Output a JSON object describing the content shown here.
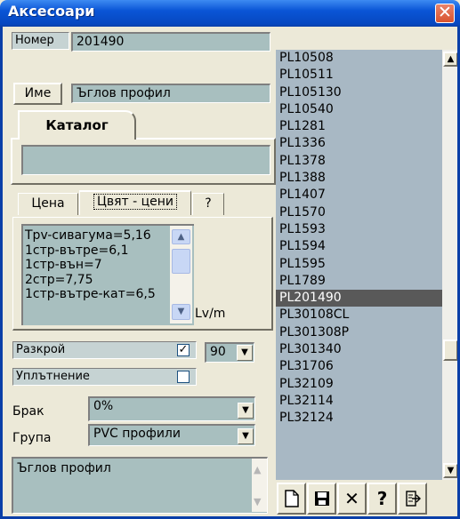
{
  "window": {
    "title": "Аксесоари",
    "close_glyph": "✕"
  },
  "fields": {
    "nomer_label": "Номер",
    "nomer_value": "201490",
    "ime_button": "Име",
    "ime_value": "Ъглов профил"
  },
  "catalog": {
    "tab_label": "Каталог",
    "value": ""
  },
  "price_tabs": [
    "Цена",
    "Цвят - цени",
    "?"
  ],
  "price_list": {
    "items": [
      "Tpv-сивагума=5,16",
      "1стр-вътре=6,1",
      "1стр-вън=7",
      "2стр=7,75",
      "1стр-вътре-кат=6,5"
    ],
    "unit": "Lv/m"
  },
  "options": {
    "razkroi_label": "Разкрой",
    "razkroi_checked": true,
    "angle_value": "90",
    "uplatnenie_label": "Уплътнение",
    "uplatnenie_checked": false,
    "brak_label": "Брак",
    "brak_value": "0%",
    "grupa_label": "Група",
    "grupa_value": "PVC профили"
  },
  "notes": {
    "value": "Ъглов профил"
  },
  "list": {
    "items": [
      "PL10508",
      "PL10511",
      "PL105130",
      "PL10540",
      "PL1281",
      "PL1336",
      "PL1378",
      "PL1388",
      "PL1407",
      "PL1570",
      "PL1593",
      "PL1594",
      "PL1595",
      "PL1789",
      "PL201490",
      "PL30108CL",
      "PL301308P",
      "PL301340",
      "PL31706",
      "PL32109",
      "PL32114",
      "PL32124"
    ],
    "selected": "PL201490"
  },
  "toolbar": {
    "new_icon": "new-document-icon",
    "save_icon": "save-icon",
    "delete_glyph": "✕",
    "help_glyph": "?",
    "exit_icon": "exit-icon"
  },
  "colors": {
    "field_bg": "#a8bfbf",
    "list_bg": "#a8b8c4",
    "selected_bg": "#595959",
    "titlebar": "#0a55d6"
  }
}
